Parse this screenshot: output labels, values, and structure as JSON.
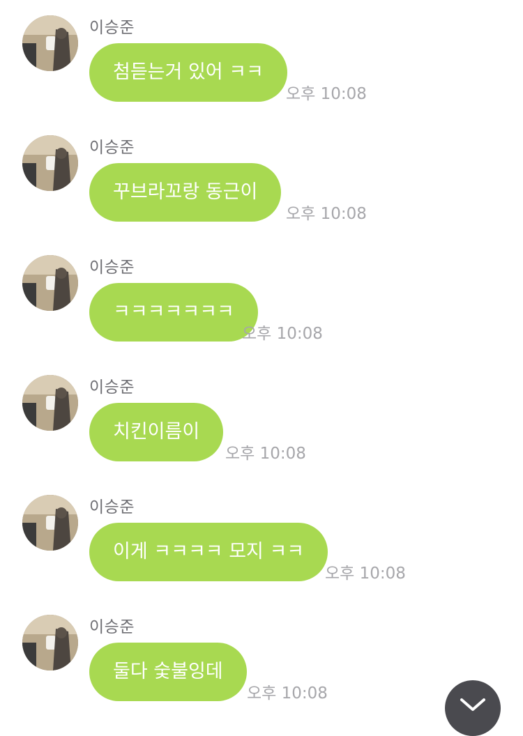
{
  "messages": [
    {
      "sender": "이승준",
      "text": "첨듣는거 있어 ㅋㅋ",
      "time": "오후 10:08"
    },
    {
      "sender": "이승준",
      "text": "꾸브라꼬랑 동근이",
      "time": "오후 10:08"
    },
    {
      "sender": "이승준",
      "text": "ㅋㅋㅋㅋㅋㅋㅋ",
      "time": "오후 10:08"
    },
    {
      "sender": "이승준",
      "text": "치킨이름이",
      "time": "오후 10:08"
    },
    {
      "sender": "이승준",
      "text": "이게 ㅋㅋㅋㅋ 모지 ㅋㅋ",
      "time": "오후 10:08"
    },
    {
      "sender": "이승준",
      "text": "둘다 숯불잉데",
      "time": "오후 10:08"
    }
  ],
  "colors": {
    "bubble": "#a8d951",
    "bubble_text": "#ffffff",
    "sender": "#6e6e73",
    "time": "#a6a6aa",
    "scroll_button": "#4a4a4f"
  },
  "icons": {
    "avatar": "profile-photo",
    "scroll_button": "chevron-down-icon"
  }
}
